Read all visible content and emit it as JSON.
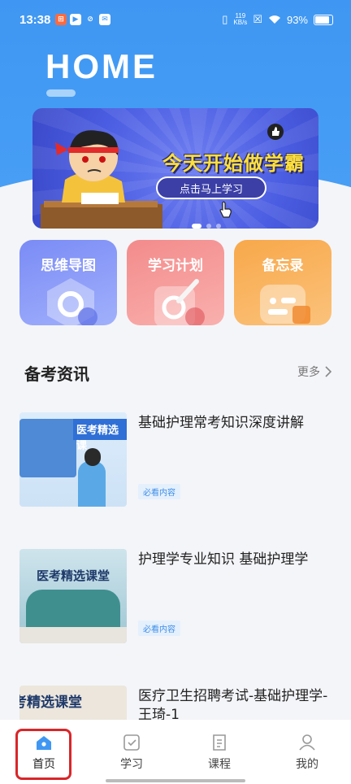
{
  "status_bar": {
    "time": "13:38",
    "net_speed_value": "119",
    "net_speed_unit": "KB/s",
    "battery": "93%"
  },
  "header": {
    "title": "HOME"
  },
  "banner": {
    "headline": "今天开始做学霸",
    "button_label": "点击马上学习"
  },
  "features": [
    {
      "label": "思维导图",
      "color": "#7a8bf6"
    },
    {
      "label": "学习计划",
      "color": "#f38b8b"
    },
    {
      "label": "备忘录",
      "color": "#f8a84a"
    }
  ],
  "section": {
    "title": "备考资讯",
    "more_label": "更多"
  },
  "news": [
    {
      "title": "基础护理常考知识深度讲解",
      "tag": "必看内容",
      "thumb_text": "医考精选课"
    },
    {
      "title": "护理学专业知识  基础护理学",
      "tag": "必看内容",
      "thumb_text": "医考精选课堂"
    },
    {
      "title": "医疗卫生招聘考试-基础护理学-王琦-1",
      "tag": "",
      "thumb_text": "考精选课堂"
    }
  ],
  "tabbar": {
    "items": [
      {
        "label": "首页",
        "icon": "home-icon",
        "active": true
      },
      {
        "label": "学习",
        "icon": "study-icon",
        "active": false
      },
      {
        "label": "课程",
        "icon": "course-icon",
        "active": false
      },
      {
        "label": "我的",
        "icon": "person-icon",
        "active": false
      }
    ],
    "accent": "#3f97f3",
    "highlight_color": "#d9262a"
  }
}
